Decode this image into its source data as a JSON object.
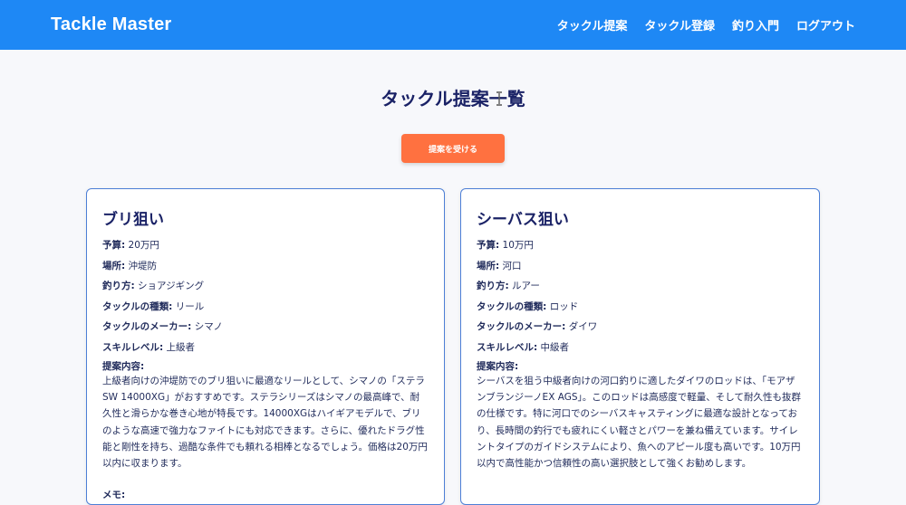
{
  "header": {
    "brand": "Tackle Master",
    "nav": [
      "タックル提案",
      "タックル登録",
      "釣り入門",
      "ログアウト"
    ]
  },
  "page": {
    "title": "タックル提案一覧",
    "suggest_button": "提案を受ける"
  },
  "labels": {
    "budget": "予算:",
    "location": "場所:",
    "method": "釣り方:",
    "tackle_type": "タックルの種類:",
    "maker": "タックルのメーカー:",
    "skill": "スキルレベル:",
    "proposal": "提案内容:",
    "memo": "メモ:"
  },
  "cards": [
    {
      "title": "ブリ狙い",
      "budget": "20万円",
      "location": "沖堤防",
      "method": "ショアジギング",
      "tackle_type": "リール",
      "maker": "シマノ",
      "skill": "上級者",
      "proposal": "上級者向けの沖堤防でのブリ狙いに最適なリールとして、シマノの「ステラ SW 14000XG」がおすすめです。ステラシリーズはシマノの最高峰で、耐久性と滑らかな巻き心地が特長です。14000XGはハイギアモデルで、ブリのような高速で強力なファイトにも対応できます。さらに、優れたドラグ性能と剛性を持ち、過酷な条件でも頼れる相棒となるでしょう。価格は20万円以内に収まります。"
    },
    {
      "title": "シーバス狙い",
      "budget": "10万円",
      "location": "河口",
      "method": "ルアー",
      "tackle_type": "ロッド",
      "maker": "ダイワ",
      "skill": "中級者",
      "proposal": "シーバスを狙う中級者向けの河口釣りに適したダイワのロッドは、「モアザンブランジーノEX AGS」。このロッドは高感度で軽量、そして耐久性も抜群の仕様です。特に河口でのシーバスキャスティングに最適な設計となっており、長時間の釣行でも疲れにくい軽さとパワーを兼ね備えています。サイレントタイプのガイドシステムにより、魚へのアピール度も高いです。10万円以内で高性能かつ信頼性の高い選択肢として強くお勧めします。"
    }
  ]
}
